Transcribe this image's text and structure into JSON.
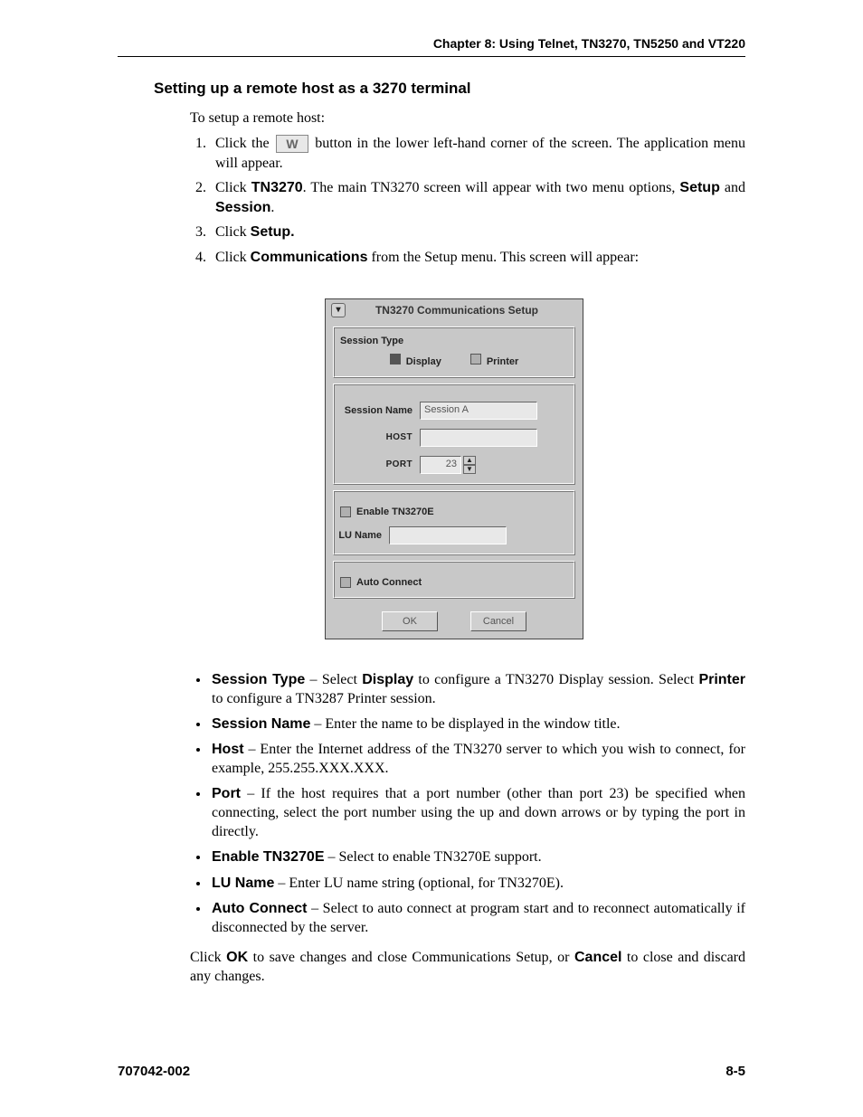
{
  "header": {
    "chapter": "Chapter 8: Using Telnet, TN3270, TN5250 and VT220"
  },
  "section": {
    "title": "Setting up a remote host as a 3270 terminal",
    "intro": "To setup a remote host:",
    "steps": [
      {
        "pre": "Click the ",
        "post": " button in the lower left-hand corner of the screen. The application menu will appear."
      },
      {
        "parts": [
          "Click ",
          "TN3270",
          ". The main TN3270 screen will appear with two menu options, ",
          "Setup",
          " and ",
          "Session",
          "."
        ]
      },
      {
        "parts": [
          "Click ",
          "Setup."
        ]
      },
      {
        "parts": [
          "Click ",
          "Communications",
          " from the Setup menu. This screen will appear:"
        ]
      }
    ]
  },
  "dialog": {
    "title": "TN3270 Communications Setup",
    "sessionType": {
      "label": "Session Type",
      "options": [
        "Display",
        "Printer"
      ]
    },
    "fields": {
      "sessionName": {
        "label": "Session Name",
        "value": "Session A"
      },
      "host": {
        "label": "HOST",
        "value": ""
      },
      "port": {
        "label": "PORT",
        "value": "23"
      }
    },
    "enableTN3270E": {
      "label": "Enable TN3270E"
    },
    "luName": {
      "label": "LU Name",
      "value": ""
    },
    "autoConnect": {
      "label": "Auto Connect"
    },
    "buttons": {
      "ok": "OK",
      "cancel": "Cancel"
    }
  },
  "bullets": [
    {
      "term": "Session Type",
      "sep": " – Select ",
      "b1": "Display",
      "mid": " to configure a TN3270 Display session. Select ",
      "b2": "Printer",
      "tail": " to configure a TN3287 Printer session."
    },
    {
      "term": "Session Name",
      "text": " – Enter the name to be displayed in the window title."
    },
    {
      "term": "Host",
      "text": " – Enter the Internet address of the TN3270 server to which you wish to connect, for example, 255.255.XXX.XXX."
    },
    {
      "term": "Port",
      "text": " – If the host requires that a port number (other than port 23) be specified when connecting, select the port number using the up and down arrows or by typing the port in directly."
    },
    {
      "term": "Enable TN3270E",
      "text": " – Select to enable TN3270E support."
    },
    {
      "term": "LU Name",
      "text": " – Enter LU name string (optional, for TN3270E)."
    },
    {
      "term": "Auto Connect",
      "text": " – Select to auto connect at program start and to reconnect automatically if disconnected by the server."
    }
  ],
  "closing": {
    "parts": [
      "Click ",
      "OK",
      " to save changes and close Communications Setup, or ",
      "Cancel",
      " to close and discard any changes."
    ]
  },
  "footer": {
    "docnum": "707042-002",
    "pagenum": "8-5"
  }
}
